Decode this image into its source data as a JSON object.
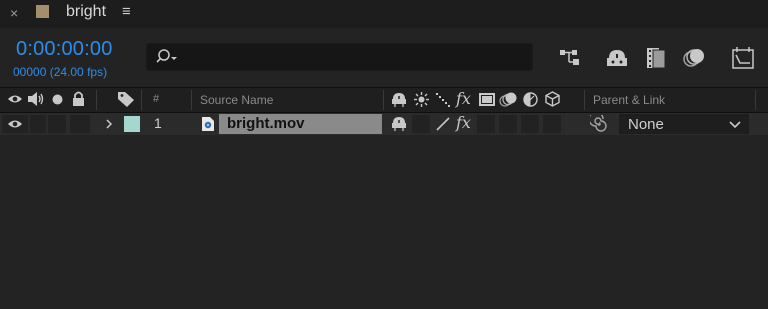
{
  "tab": {
    "close_glyph": "×",
    "title": "bright",
    "menu_glyph": "≡",
    "swatch_color": "#a58e6a"
  },
  "timecode": {
    "current": "0:00:00:00",
    "frames": "00000 (24.00 fps)",
    "color": "#2d8ceb"
  },
  "search": {
    "placeholder": "",
    "icon": "search-icon"
  },
  "toolbar": {
    "icons": [
      "composition-flowchart-icon",
      "shy-icon",
      "frame-blending-icon",
      "motion-blur-icon",
      "graph-editor-icon"
    ]
  },
  "columns": {
    "av_icons": [
      "eye-icon",
      "speaker-icon",
      "solo-icon",
      "lock-icon"
    ],
    "label_icon": "tag-icon",
    "number": "#",
    "source_name": "Source Name",
    "switch_icons": [
      "shy-icon",
      "collapse-icon",
      "quality-icon",
      "fx-icon",
      "frame-blend-icon",
      "motion-blur-icon",
      "adjustment-icon",
      "3d-icon"
    ],
    "parent_link": "Parent & Link"
  },
  "layers": [
    {
      "number": "1",
      "name": "bright.mov",
      "label_color": "#a6d7cf",
      "parent": "None"
    }
  ]
}
